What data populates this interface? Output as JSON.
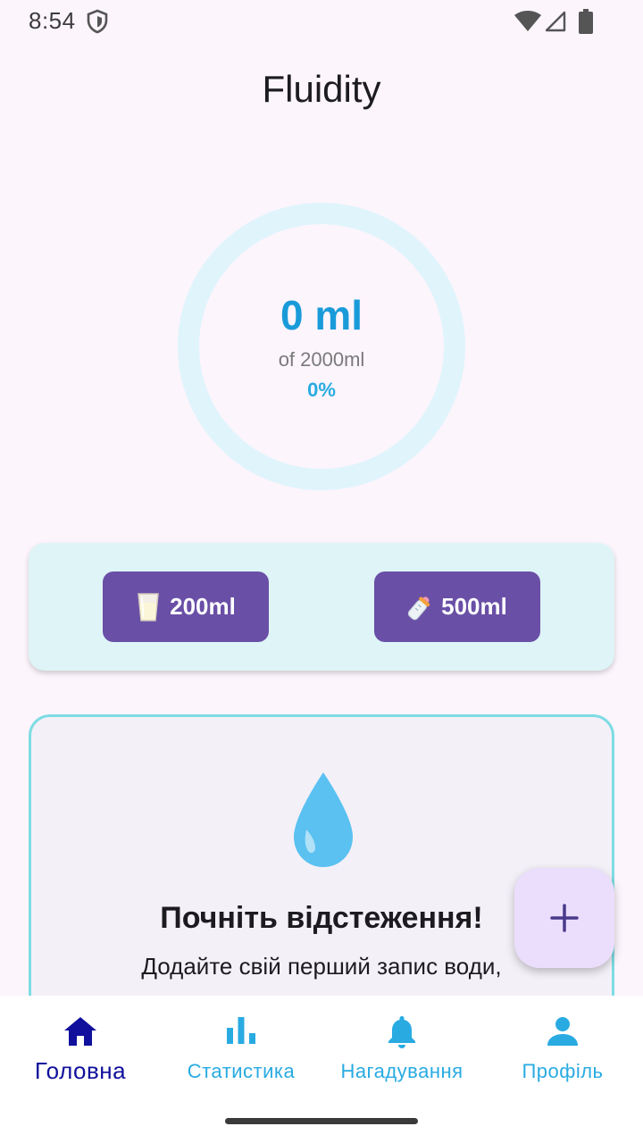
{
  "status_bar": {
    "time": "8:54"
  },
  "app": {
    "title": "Fluidity"
  },
  "progress": {
    "amount_text": "0 ml",
    "goal_text": "of 2000ml",
    "percent_text": "0%",
    "fraction": 0,
    "ring_color": "#e0f4fc",
    "fill_color": "#29abe2"
  },
  "quick_add": {
    "buttons": [
      {
        "label": "200ml",
        "icon": "milk-glass-icon"
      },
      {
        "label": "500ml",
        "icon": "baby-bottle-icon"
      }
    ]
  },
  "empty_state": {
    "icon": "water-drop-icon",
    "title": "Почніть відстеження!",
    "subtitle": "Додайте свій перший запис води,"
  },
  "fab": {
    "icon": "plus-icon"
  },
  "bottom_nav": {
    "items": [
      {
        "label": "Головна",
        "icon": "home-icon",
        "active": true
      },
      {
        "label": "Статистика",
        "icon": "bar-chart-icon",
        "active": false
      },
      {
        "label": "Нагадування",
        "icon": "bell-icon",
        "active": false
      },
      {
        "label": "Профіль",
        "icon": "person-icon",
        "active": false
      }
    ]
  },
  "colors": {
    "accent": "#29abe2",
    "button": "#6a4fa6",
    "active_nav": "#10109c",
    "background": "#fcf5fc"
  }
}
